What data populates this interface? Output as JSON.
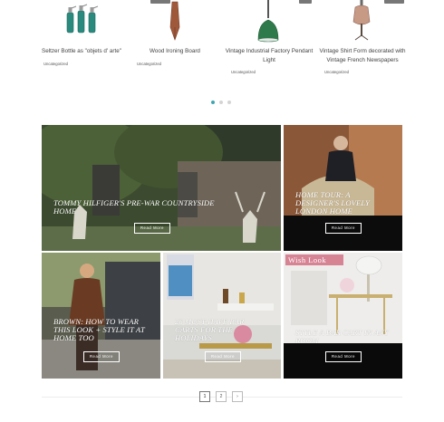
{
  "products": [
    {
      "name": "Seltzer Bottle as \"objets d' arte\"",
      "category": "Uncategorized"
    },
    {
      "name": "Wood Ironing Board",
      "category": "Uncategorized"
    },
    {
      "name": "Vintage Industrial Factory Pendant Light",
      "category": "Uncategorized"
    },
    {
      "name": "Vintage Shirt Form decorated with Vintage French Newspapers",
      "category": "Uncategorized"
    }
  ],
  "carousel": {
    "pages": 3,
    "active": 0
  },
  "posts": [
    {
      "title": "Tommy Hilfiger's Pre-War Countryside Home",
      "button": "Read More"
    },
    {
      "title": "Home Tour: A Designer's Lovely London Home",
      "button": "Read More"
    },
    {
      "title": "Brown: How to Wear This Look + Style It at Home Too",
      "button": "Read More"
    },
    {
      "title": "26 Must-Have Bar Carts for the Holidays",
      "button": "Read More"
    },
    {
      "title": "Style a Bar Cart in Any Room",
      "button": "Read More",
      "badge": "Wish Look"
    }
  ],
  "pagination": {
    "pages": [
      "1",
      "2",
      "›"
    ],
    "current": "1"
  },
  "colors": {
    "accent": "#3fa6b1",
    "badge": "#d68394"
  }
}
